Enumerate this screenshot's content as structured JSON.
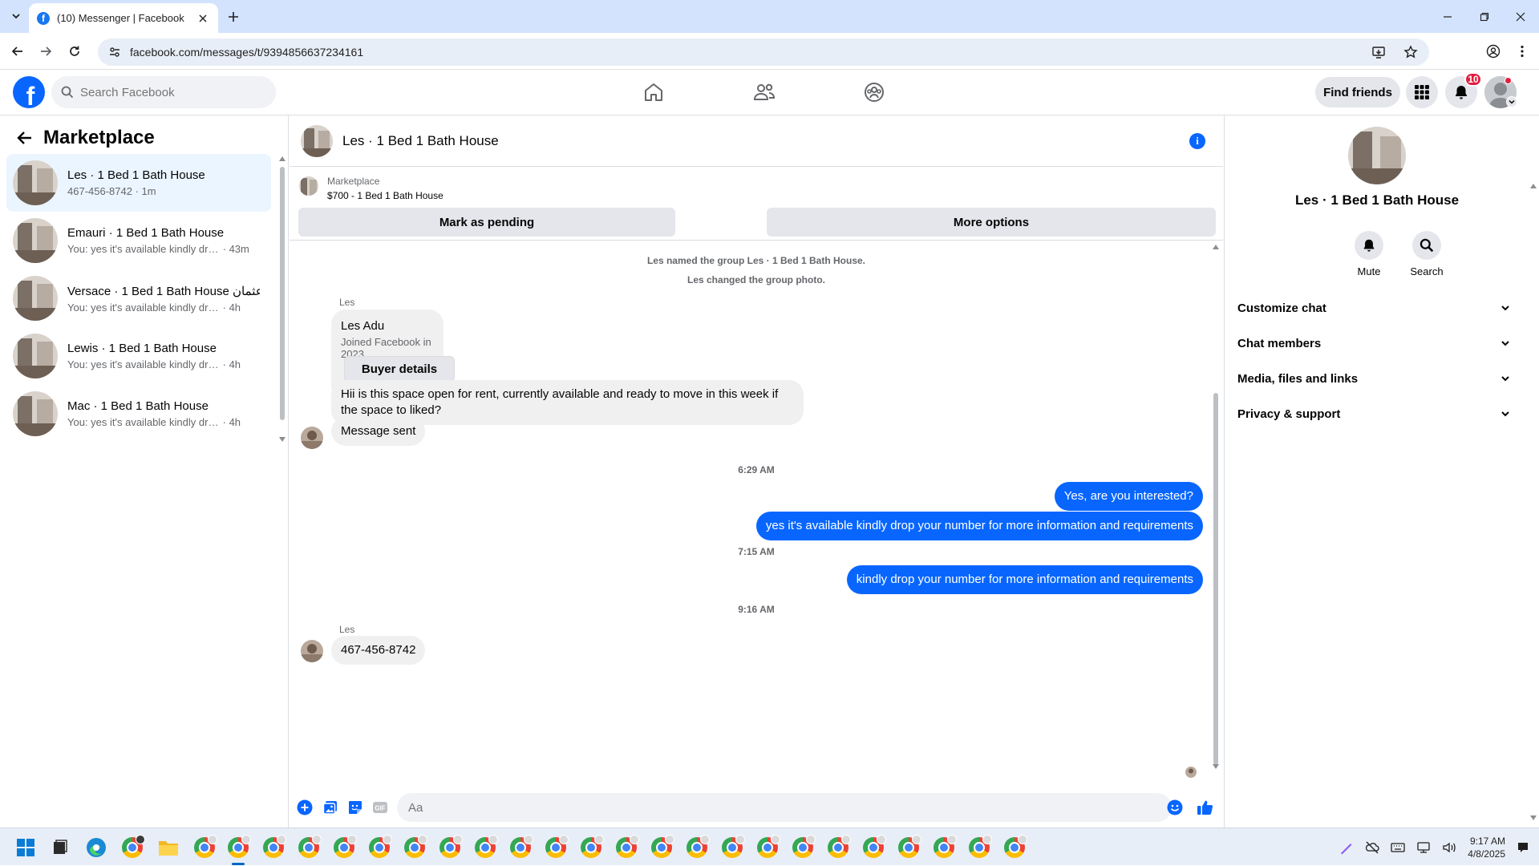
{
  "browser": {
    "tab_title": "(10) Messenger | Facebook",
    "url": "facebook.com/messages/t/9394856637234161"
  },
  "fb": {
    "search_placeholder": "Search Facebook",
    "find_friends": "Find friends",
    "notif_count": "10",
    "brand_color": "#0866ff"
  },
  "sidebar": {
    "title": "Marketplace",
    "conversations": [
      {
        "name": "Les · 1 Bed 1 Bath House",
        "snippet": "467-456-8742",
        "time": "· 1m"
      },
      {
        "name": "Emauri · 1 Bed 1 Bath House",
        "snippet": "You: yes it's available kindly drop ...",
        "time": "· 43m"
      },
      {
        "name": "Versace · 1 Bed 1 Bath House عثمان",
        "snippet": "You: yes it's available kindly drop y...",
        "time": "· 4h"
      },
      {
        "name": "Lewis · 1 Bed 1 Bath House",
        "snippet": "You: yes it's available kindly drop y...",
        "time": "· 4h"
      },
      {
        "name": "Mac · 1 Bed 1 Bath House",
        "snippet": "You: yes it's available kindly drop y...",
        "time": "· 4h"
      }
    ]
  },
  "chat": {
    "title": "Les · 1 Bed 1 Bath House",
    "marketplace_label": "Marketplace",
    "listing": "$700 - 1 Bed 1 Bath House",
    "mark_pending": "Mark as pending",
    "more_options": "More options",
    "system1": "Les named the group Les · 1 Bed 1 Bath House.",
    "system2": "Les changed the group photo.",
    "sender1": "Les",
    "buyer_name": "Les Adu",
    "buyer_joined": "Joined Facebook in 2023",
    "buyer_details": "Buyer details",
    "msg_in1": "Hii is this space open for rent, currently available and ready to move in this week if the space to liked?",
    "msg_in2": "Message sent",
    "ts1": "6:29 AM",
    "msg_out1": "Yes, are you interested?",
    "msg_out2": "yes it's available kindly drop your number for more information and requirements",
    "ts2": "7:15 AM",
    "msg_out3": "kindly drop your number for more information and requirements",
    "ts3": "9:16 AM",
    "sender2": "Les",
    "msg_in3": "467-456-8742",
    "composer_placeholder": "Aa"
  },
  "rpanel": {
    "name": "Les · 1 Bed 1 Bath House",
    "mute": "Mute",
    "search": "Search",
    "rows": [
      "Customize chat",
      "Chat members",
      "Media, files and links",
      "Privacy & support"
    ]
  },
  "taskbar": {
    "time": "9:17 AM",
    "date": "4/8/2025"
  }
}
